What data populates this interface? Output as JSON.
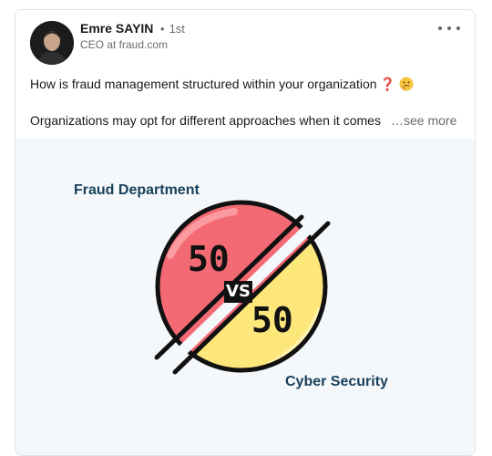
{
  "post": {
    "author": {
      "name": "Emre SAYIN",
      "separator": "•",
      "degree": "1st",
      "headline": "CEO at fraud.com"
    },
    "text": {
      "line1": "How is fraud management structured within your organization",
      "line1_emoji_1": "❓",
      "line1_emoji_2": "thinking-face",
      "line2": "Organizations may opt for different approaches when it comes",
      "see_more": "…see more"
    },
    "menu_icon": "more-horizontal-icon"
  },
  "image": {
    "top_label": "Fraud Department",
    "bottom_label": "Cyber Security",
    "left_value": "50",
    "right_value": "50",
    "vs_text": "VS",
    "colors": {
      "red": "#f46a74",
      "yellow": "#fde67a",
      "outline": "#111111",
      "label": "#173f5a",
      "background": "#f5f8fb"
    }
  }
}
